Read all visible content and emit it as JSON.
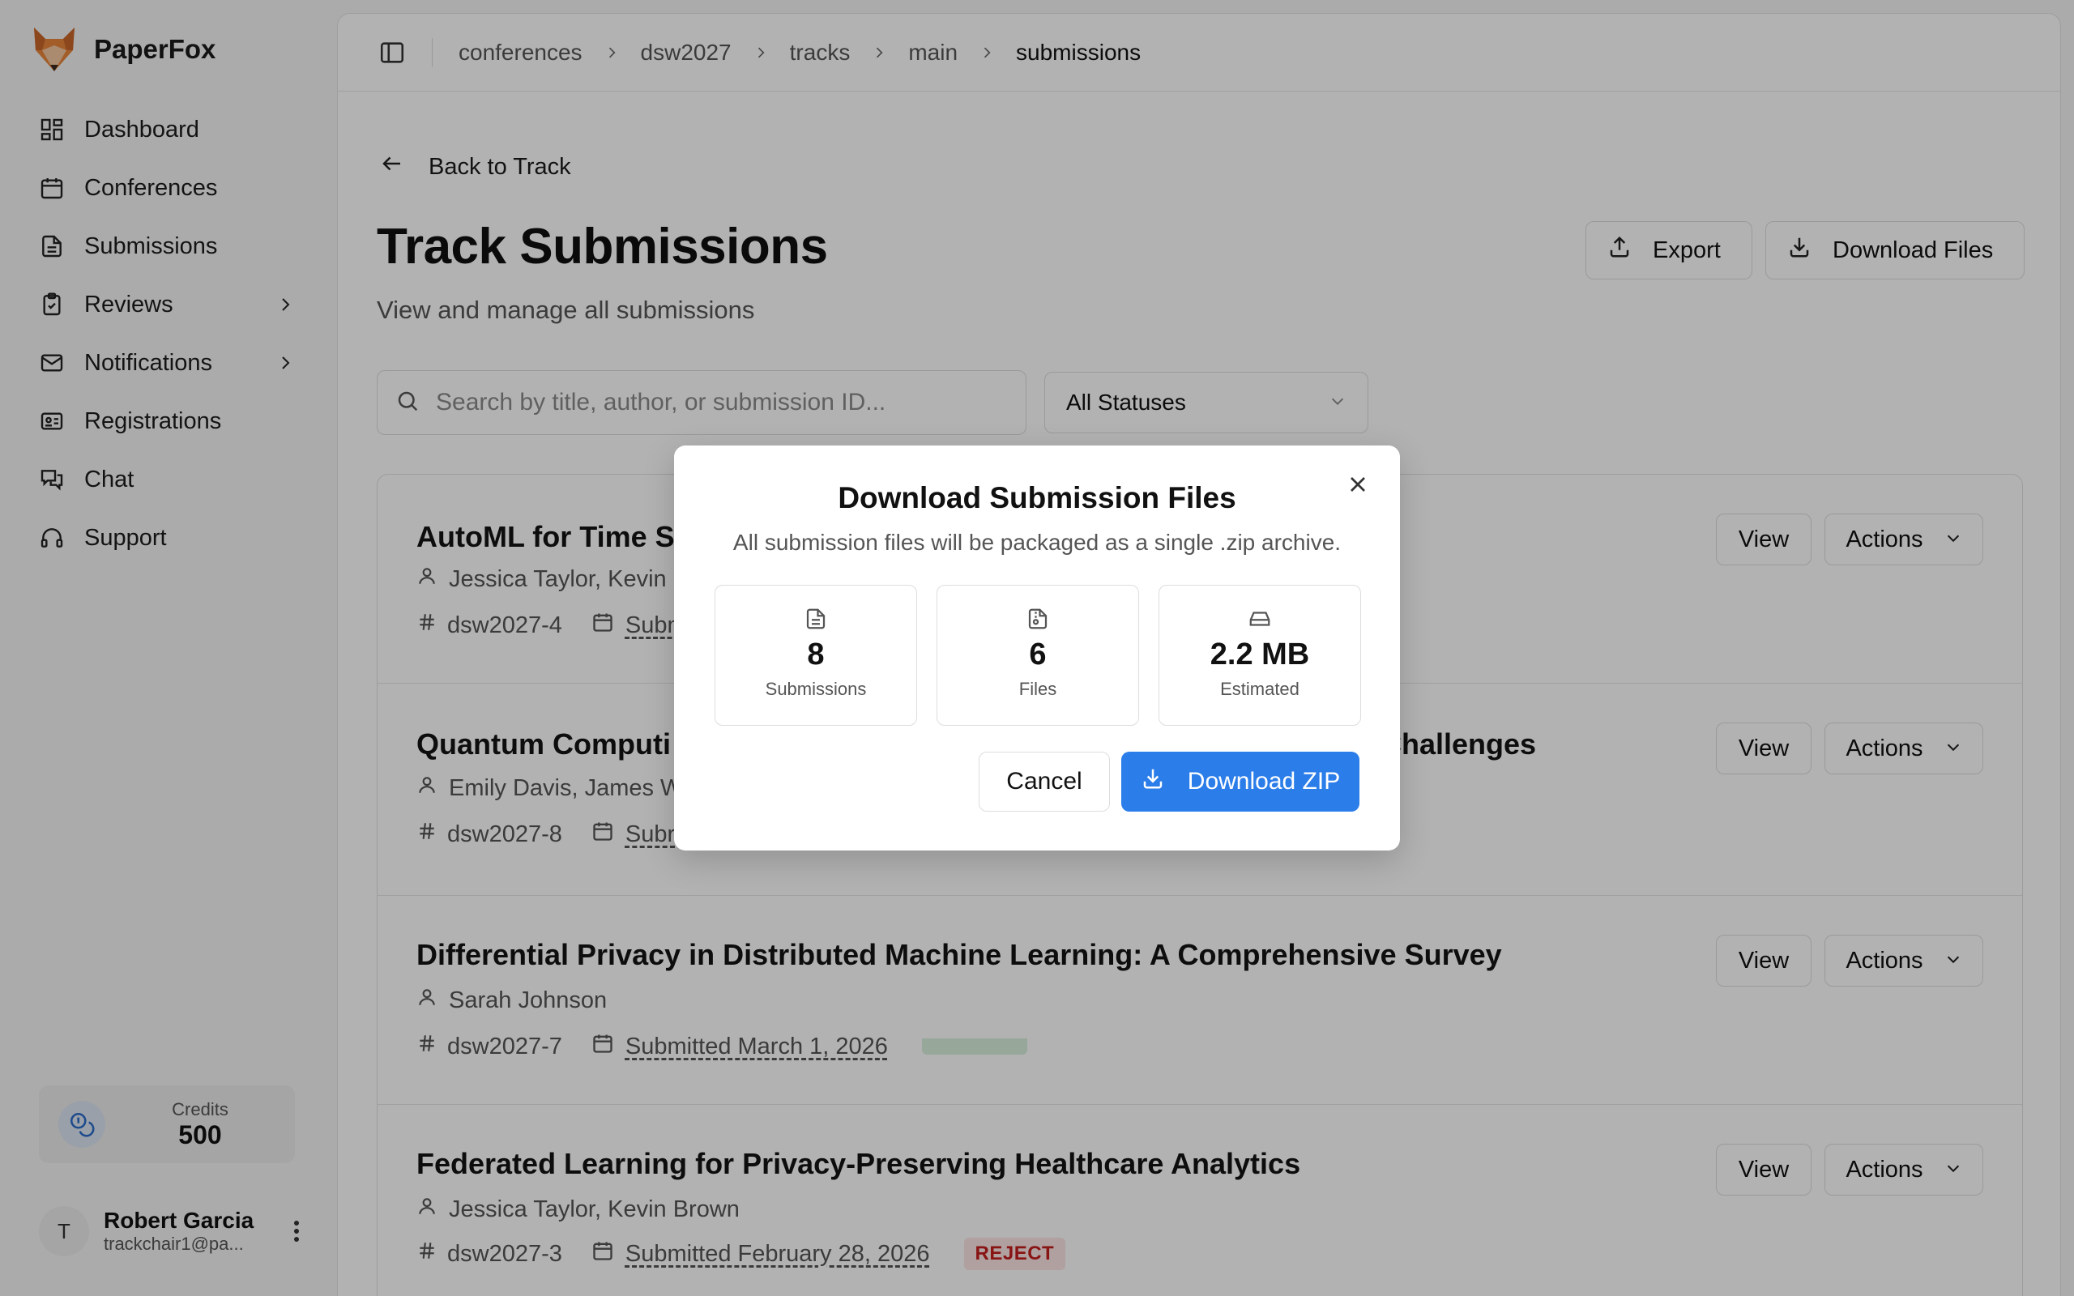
{
  "app": {
    "name": "PaperFox"
  },
  "sidebar": {
    "items": [
      {
        "label": "Dashboard",
        "icon": "dashboard-icon"
      },
      {
        "label": "Conferences",
        "icon": "calendar-icon"
      },
      {
        "label": "Submissions",
        "icon": "file-text-icon"
      },
      {
        "label": "Reviews",
        "icon": "clipboard-check-icon",
        "expandable": true
      },
      {
        "label": "Notifications",
        "icon": "mail-icon",
        "expandable": true
      },
      {
        "label": "Registrations",
        "icon": "id-card-icon"
      },
      {
        "label": "Chat",
        "icon": "chat-icon"
      },
      {
        "label": "Support",
        "icon": "headphones-icon"
      }
    ],
    "credits": {
      "label": "Credits",
      "value": "500"
    },
    "user": {
      "initial": "T",
      "name": "Robert Garcia",
      "email": "trackchair1@pa..."
    }
  },
  "breadcrumb": [
    "conferences",
    "dsw2027",
    "tracks",
    "main",
    "submissions"
  ],
  "page": {
    "back_label": "Back to Track",
    "title": "Track Submissions",
    "subtitle": "View and manage all submissions",
    "export_label": "Export",
    "download_files_label": "Download Files"
  },
  "filters": {
    "search_placeholder": "Search by title, author, or submission ID...",
    "status_value": "All Statuses"
  },
  "submissions": [
    {
      "title": "AutoML for Time S",
      "authors": "Jessica Taylor, Kevin I",
      "id": "dsw2027-4",
      "date": "Subm",
      "status": ""
    },
    {
      "title": "Quantum Computi",
      "title_tail": "d Challenges",
      "authors": "Emily Davis, James W",
      "id": "dsw2027-8",
      "date": "Subr",
      "status": ""
    },
    {
      "title": "Differential Privacy in Distributed Machine Learning: A Comprehensive Survey",
      "authors": "Sarah Johnson",
      "id": "dsw2027-7",
      "date": "Submitted March 1, 2026",
      "status": ""
    },
    {
      "title": "Federated Learning for Privacy-Preserving Healthcare Analytics",
      "authors": "Jessica Taylor, Kevin Brown",
      "id": "dsw2027-3",
      "date": "Submitted February 28, 2026",
      "status": "REJECT"
    }
  ],
  "row_actions": {
    "view": "View",
    "actions": "Actions"
  },
  "modal": {
    "title": "Download Submission Files",
    "description": "All submission files will be packaged as a single .zip archive.",
    "stats": [
      {
        "value": "8",
        "label": "Submissions",
        "icon": "file-text-icon"
      },
      {
        "value": "6",
        "label": "Files",
        "icon": "file-archive-icon"
      },
      {
        "value": "2.2 MB",
        "label": "Estimated",
        "icon": "hard-drive-icon"
      }
    ],
    "cancel_label": "Cancel",
    "download_label": "Download ZIP"
  },
  "colors": {
    "primary": "#2b7de9",
    "reject_bg": "#fde6e6",
    "reject_text": "#c41d1d"
  }
}
